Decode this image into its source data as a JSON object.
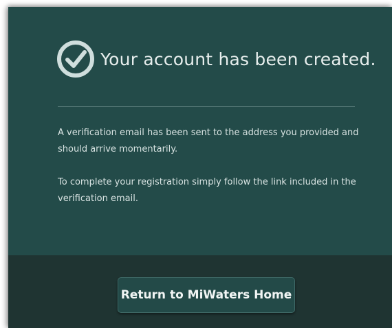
{
  "confirmation": {
    "title": "Your account has been created.",
    "message_1": "A verification email has been sent to the address you provided and should arrive momentarily.",
    "message_2": "To complete your registration simply follow the link included in the verification email.",
    "icon": "check-circle-icon"
  },
  "actions": {
    "return_label": "Return to MiWaters Home"
  },
  "colors": {
    "panel": "#234b49",
    "footer": "#1f3432",
    "button": "#234a48",
    "text": "#e7eeed"
  }
}
